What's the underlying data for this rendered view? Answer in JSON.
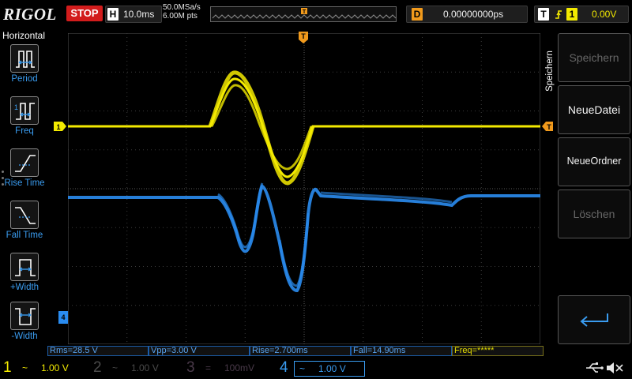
{
  "brand": "RIGOL",
  "run_state": "STOP",
  "horizontal": {
    "key": "H",
    "timebase": "10.0ms"
  },
  "acquisition": {
    "sample_rate": "50.0MSa/s",
    "memory_depth": "6.00M pts"
  },
  "delay": {
    "key": "D",
    "value": "0.00000000ps"
  },
  "trigger": {
    "key": "T",
    "source": "1",
    "level": "0.00V",
    "marker": "T"
  },
  "left_menu": {
    "title": "Horizontal",
    "items": [
      {
        "label": "Period",
        "icon": "period-icon"
      },
      {
        "label": "Freq",
        "icon": "frequency-icon"
      },
      {
        "label": "Rise Time",
        "icon": "rise-time-icon"
      },
      {
        "label": "Fall Time",
        "icon": "fall-time-icon"
      },
      {
        "label": "+Width",
        "icon": "positive-width-icon"
      },
      {
        "label": "-Width",
        "icon": "negative-width-icon"
      }
    ]
  },
  "right_menu": {
    "tab": "Speichern",
    "buttons": [
      {
        "label": "Speichern",
        "enabled": false
      },
      {
        "label": "NeueDatei",
        "enabled": true
      },
      {
        "label": "NeueOrdner",
        "enabled": true
      },
      {
        "label": "Löschen",
        "enabled": false
      }
    ],
    "enter_icon": "enter-return-icon"
  },
  "measurements": [
    {
      "text": "Rms=28.5 V",
      "channel": 4
    },
    {
      "text": "Vpp=3.00 V",
      "channel": 4
    },
    {
      "text": "Rise=2.700ms",
      "channel": 4
    },
    {
      "text": "Fall=14.90ms",
      "channel": 4
    },
    {
      "text": "Freq=*****",
      "channel": 1
    }
  ],
  "channels": [
    {
      "num": "1",
      "coupling": "~",
      "scale": "1.00 V",
      "active": true,
      "color": "#f3ea00"
    },
    {
      "num": "2",
      "coupling": "~",
      "scale": "1.00 V",
      "active": false,
      "color": "#4a4a4a"
    },
    {
      "num": "3",
      "coupling": "=",
      "scale": "100mV",
      "active": false,
      "color": "#4a3a4a"
    },
    {
      "num": "4",
      "coupling": "~",
      "scale": "1.00 V",
      "active": true,
      "color": "#3a9cf0"
    }
  ],
  "channel_markers": {
    "ch1_left": "1",
    "ch1_right": "T",
    "ch4_bottom": "4"
  },
  "status_icons": [
    "usb-icon",
    "speaker-muted-icon"
  ]
}
